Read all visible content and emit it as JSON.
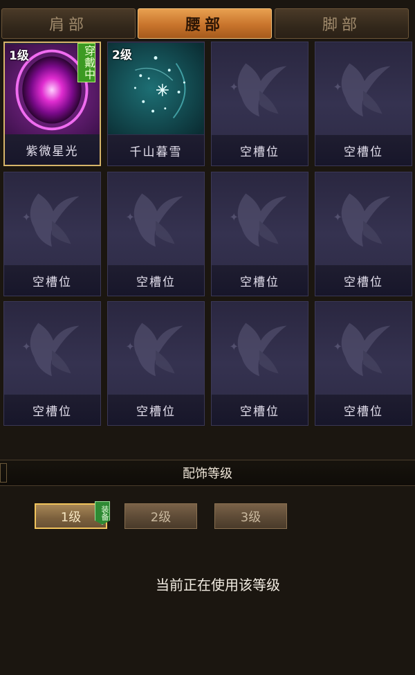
{
  "tabs": [
    {
      "label": "肩部",
      "active": false
    },
    {
      "label": "腰部",
      "active": true
    },
    {
      "label": "脚部",
      "active": false
    }
  ],
  "slots": [
    {
      "name": "紫微星光",
      "level": "1级",
      "wearing": "穿戴中",
      "art": "purple-orb"
    },
    {
      "name": "千山暮雪",
      "level": "2级",
      "art": "teal-snow"
    },
    {
      "name": "空槽位",
      "art": "butterfly"
    },
    {
      "name": "空槽位",
      "art": "butterfly"
    },
    {
      "name": "空槽位",
      "art": "butterfly"
    },
    {
      "name": "空槽位",
      "art": "butterfly"
    },
    {
      "name": "空槽位",
      "art": "butterfly"
    },
    {
      "name": "空槽位",
      "art": "butterfly"
    },
    {
      "name": "空槽位",
      "art": "butterfly"
    },
    {
      "name": "空槽位",
      "art": "butterfly"
    },
    {
      "name": "空槽位",
      "art": "butterfly"
    },
    {
      "name": "空槽位",
      "art": "butterfly"
    }
  ],
  "section": {
    "title": "配饰等级"
  },
  "levels": [
    {
      "label": "1级",
      "active": true,
      "badge": "装备"
    },
    {
      "label": "2级",
      "active": false
    },
    {
      "label": "3级",
      "active": false
    }
  ],
  "status_text": "当前正在使用该等级",
  "colors": {
    "active_tab": "#c8742c",
    "wearing_badge": "#3c9a22",
    "selected_border": "#d7b56a"
  }
}
